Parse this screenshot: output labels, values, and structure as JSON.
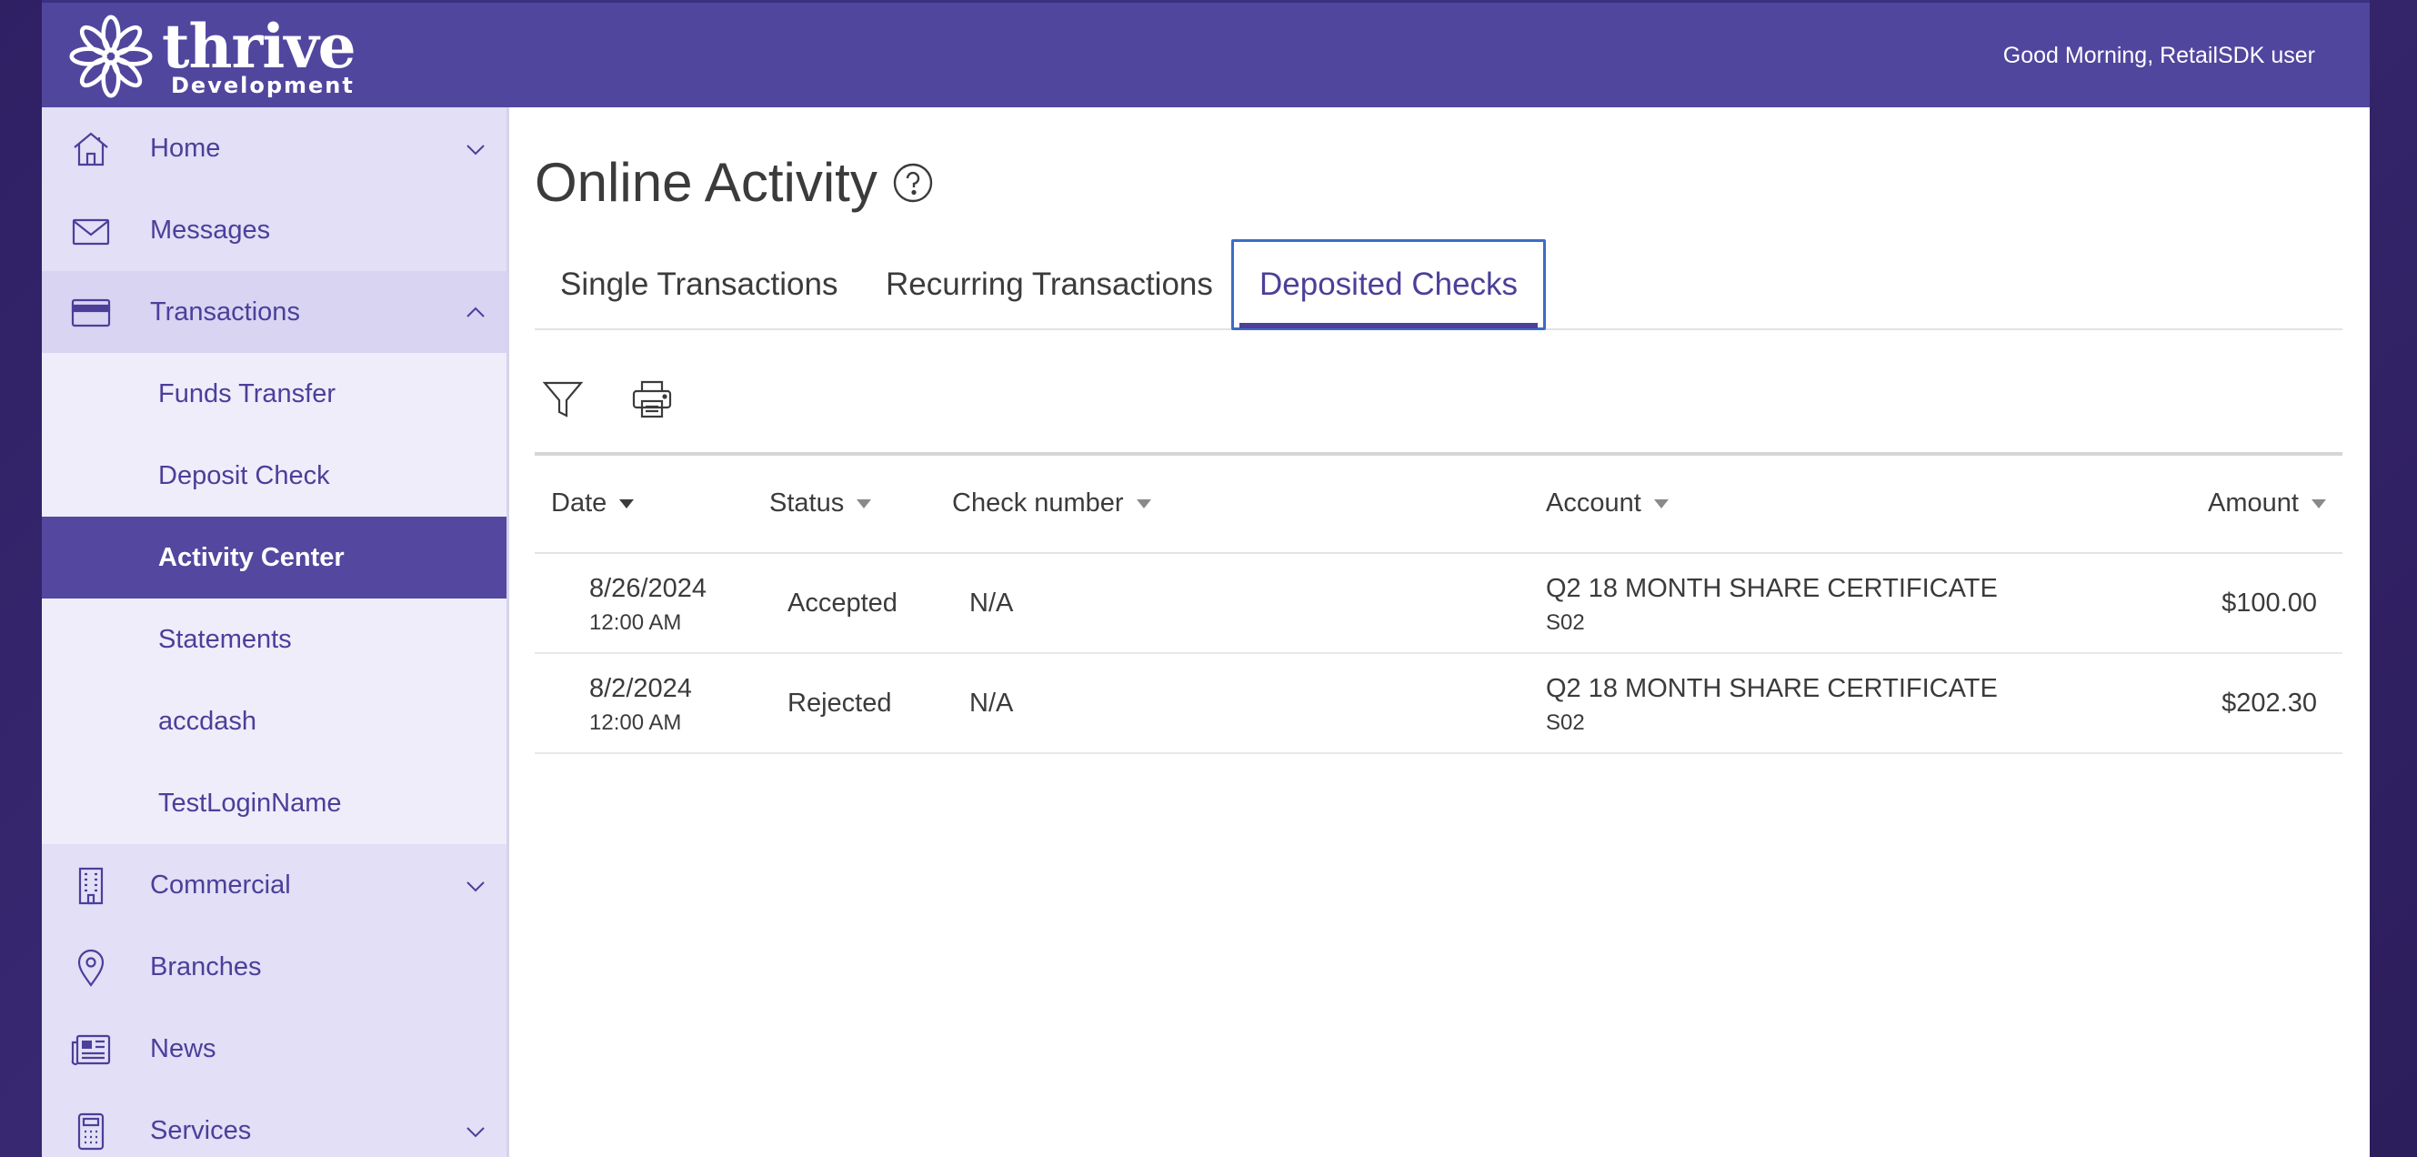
{
  "header": {
    "logo_word": "thrive",
    "logo_sub": "Development",
    "greeting": "Good Morning, RetailSDK user"
  },
  "sidebar": {
    "items": [
      {
        "label": "Home",
        "icon": "home-icon",
        "has_chevron": "down"
      },
      {
        "label": "Messages",
        "icon": "envelope-icon"
      },
      {
        "label": "Transactions",
        "icon": "card-icon",
        "has_chevron": "up"
      },
      {
        "label": "Commercial",
        "icon": "building-icon",
        "has_chevron": "down"
      },
      {
        "label": "Branches",
        "icon": "location-pin-icon"
      },
      {
        "label": "News",
        "icon": "newspaper-icon"
      },
      {
        "label": "Services",
        "icon": "calculator-icon",
        "has_chevron": "down"
      }
    ],
    "sub_items": [
      {
        "label": "Funds Transfer"
      },
      {
        "label": "Deposit Check"
      },
      {
        "label": "Activity Center",
        "active": true
      },
      {
        "label": "Statements"
      },
      {
        "label": "accdash"
      },
      {
        "label": "TestLoginName"
      }
    ]
  },
  "main": {
    "title": "Online Activity",
    "tabs": [
      {
        "label": "Single Transactions"
      },
      {
        "label": "Recurring Transactions"
      },
      {
        "label": "Deposited Checks",
        "active": true
      }
    ],
    "table": {
      "columns": [
        "Date",
        "Status",
        "Check number",
        "Account",
        "Amount"
      ],
      "rows": [
        {
          "date": "8/26/2024",
          "time": "12:00 AM",
          "status": "Accepted",
          "check_number": "N/A",
          "account": "Q2 18 MONTH SHARE CERTIFICATE",
          "account_sub": "S02",
          "amount": "$100.00"
        },
        {
          "date": "8/2/2024",
          "time": "12:00 AM",
          "status": "Rejected",
          "check_number": "N/A",
          "account": "Q2 18 MONTH SHARE CERTIFICATE",
          "account_sub": "S02",
          "amount": "$202.30"
        }
      ]
    }
  },
  "colors": {
    "brand": "#51469e",
    "sidebar_bg": "#e2dff6",
    "active_item": "#54479f",
    "tab_focus": "#3b6cc9"
  }
}
